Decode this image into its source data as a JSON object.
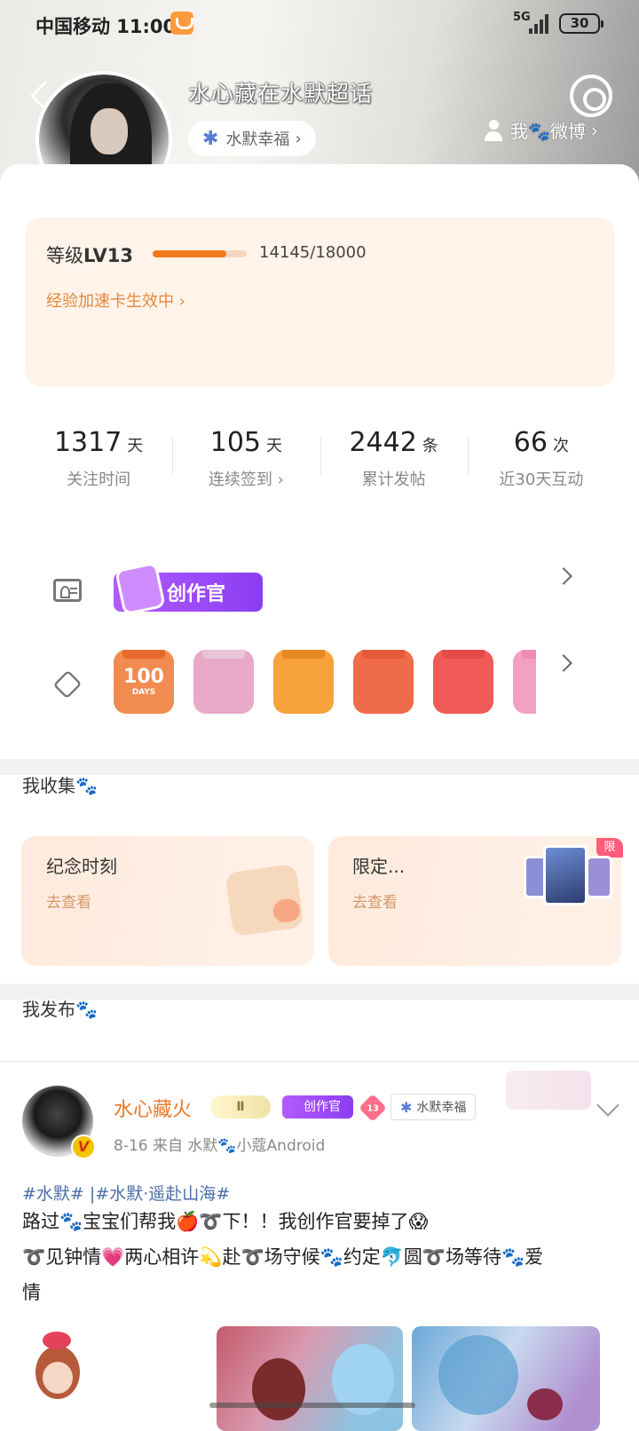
{
  "status_bar": {
    "carrier_time": "中国移动 11:00",
    "network": "5G",
    "battery": "30"
  },
  "header": {
    "title": "水心藏在水默超话",
    "topic_chip": "水默幸福",
    "my_weibo": "我🐾微博",
    "icons": [
      "back-icon",
      "gear-icon",
      "person-icon",
      "verified-v-icon",
      "snowflake-icon"
    ]
  },
  "level": {
    "label": "等级",
    "value": "LV13",
    "progress_text": "14145/18000",
    "progress_fraction": 0.786,
    "boost_text": "经验加速卡生效中"
  },
  "stats": [
    {
      "value": "1317",
      "unit": "天",
      "label": "关注时间"
    },
    {
      "value": "105",
      "unit": "天",
      "label": "连续签到"
    },
    {
      "value": "2442",
      "unit": "条",
      "label": "累计发帖"
    },
    {
      "value": "66",
      "unit": "次",
      "label": "近30天互动"
    }
  ],
  "honors": {
    "badge_label": "创作官",
    "medal_days_text": "100",
    "medal_days_unit": "DAYS",
    "medal_colors": [
      "#f28b50",
      "#e9a9c9",
      "#f7a23b",
      "#ef6b4a",
      "#f05a57",
      "#f4a0c2"
    ]
  },
  "collect": {
    "title": "我收集🐾",
    "cards": [
      {
        "title": "纪念时刻",
        "sub": "去查看"
      },
      {
        "title": "限定...",
        "sub": "去查看",
        "tag": "限"
      }
    ]
  },
  "publish": {
    "title": "我发布🐾",
    "post": {
      "author": "水心藏火",
      "level_badge": "Ⅱ",
      "creator_badge": "创作官",
      "fan_level": "13",
      "topic": "水默幸福",
      "meta": "8-16  来自 水默🐾小蔻Android",
      "tags": "#水默#  |#水默·遥赴山海#",
      "line1": "路过🐾宝宝们帮我🍎➰下！！我创作官要掉了😱",
      "line2": "➰见钟情💗两心相许💫赴➰场守候🐾约定🐬圆➰场等待🐾爱",
      "line3": "情"
    }
  },
  "colors": {
    "accent_orange": "#f27a1c",
    "creator_purple": "#9b49f6",
    "link_blue": "#4a6ea8",
    "name_orange": "#e8792b"
  }
}
